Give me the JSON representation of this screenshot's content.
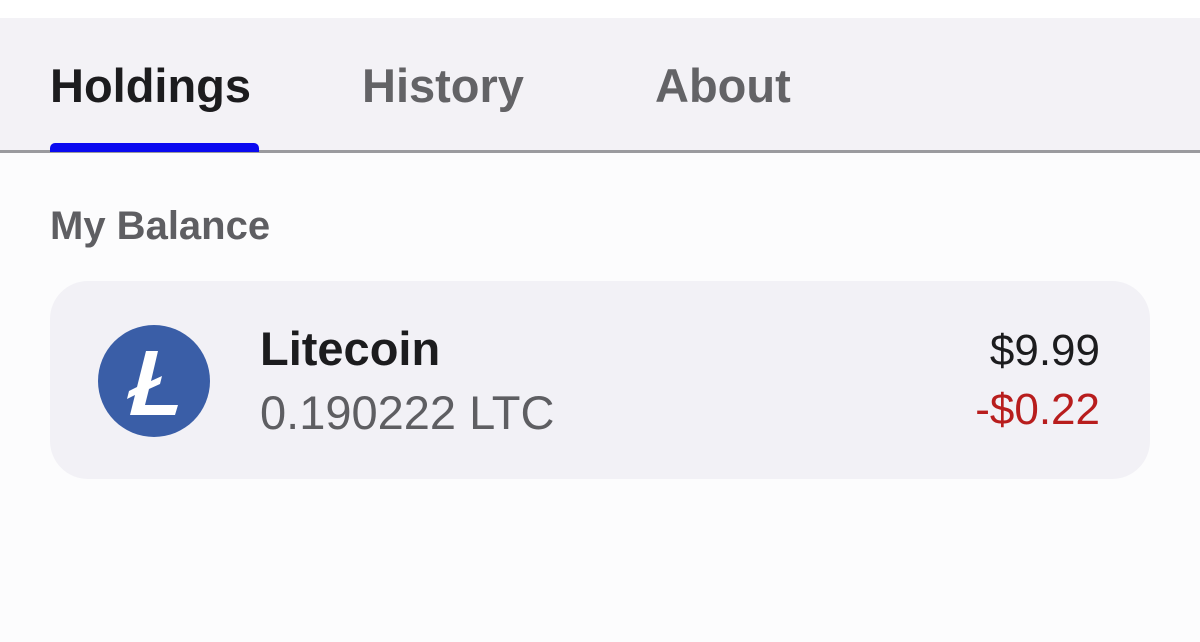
{
  "tabs": [
    {
      "label": "Holdings",
      "active": true
    },
    {
      "label": "History",
      "active": false
    },
    {
      "label": "About",
      "active": false
    }
  ],
  "colors": {
    "active_tab_indicator": "#0a0af0",
    "negative_change": "#b81d1d",
    "coin_icon_bg": "#3a5ea7"
  },
  "balance": {
    "section_title": "My Balance",
    "holdings": [
      {
        "icon": "litecoin-icon",
        "name": "Litecoin",
        "amount": "0.190222 LTC",
        "value": "$9.99",
        "change": "-$0.22",
        "change_direction": "negative"
      }
    ]
  }
}
